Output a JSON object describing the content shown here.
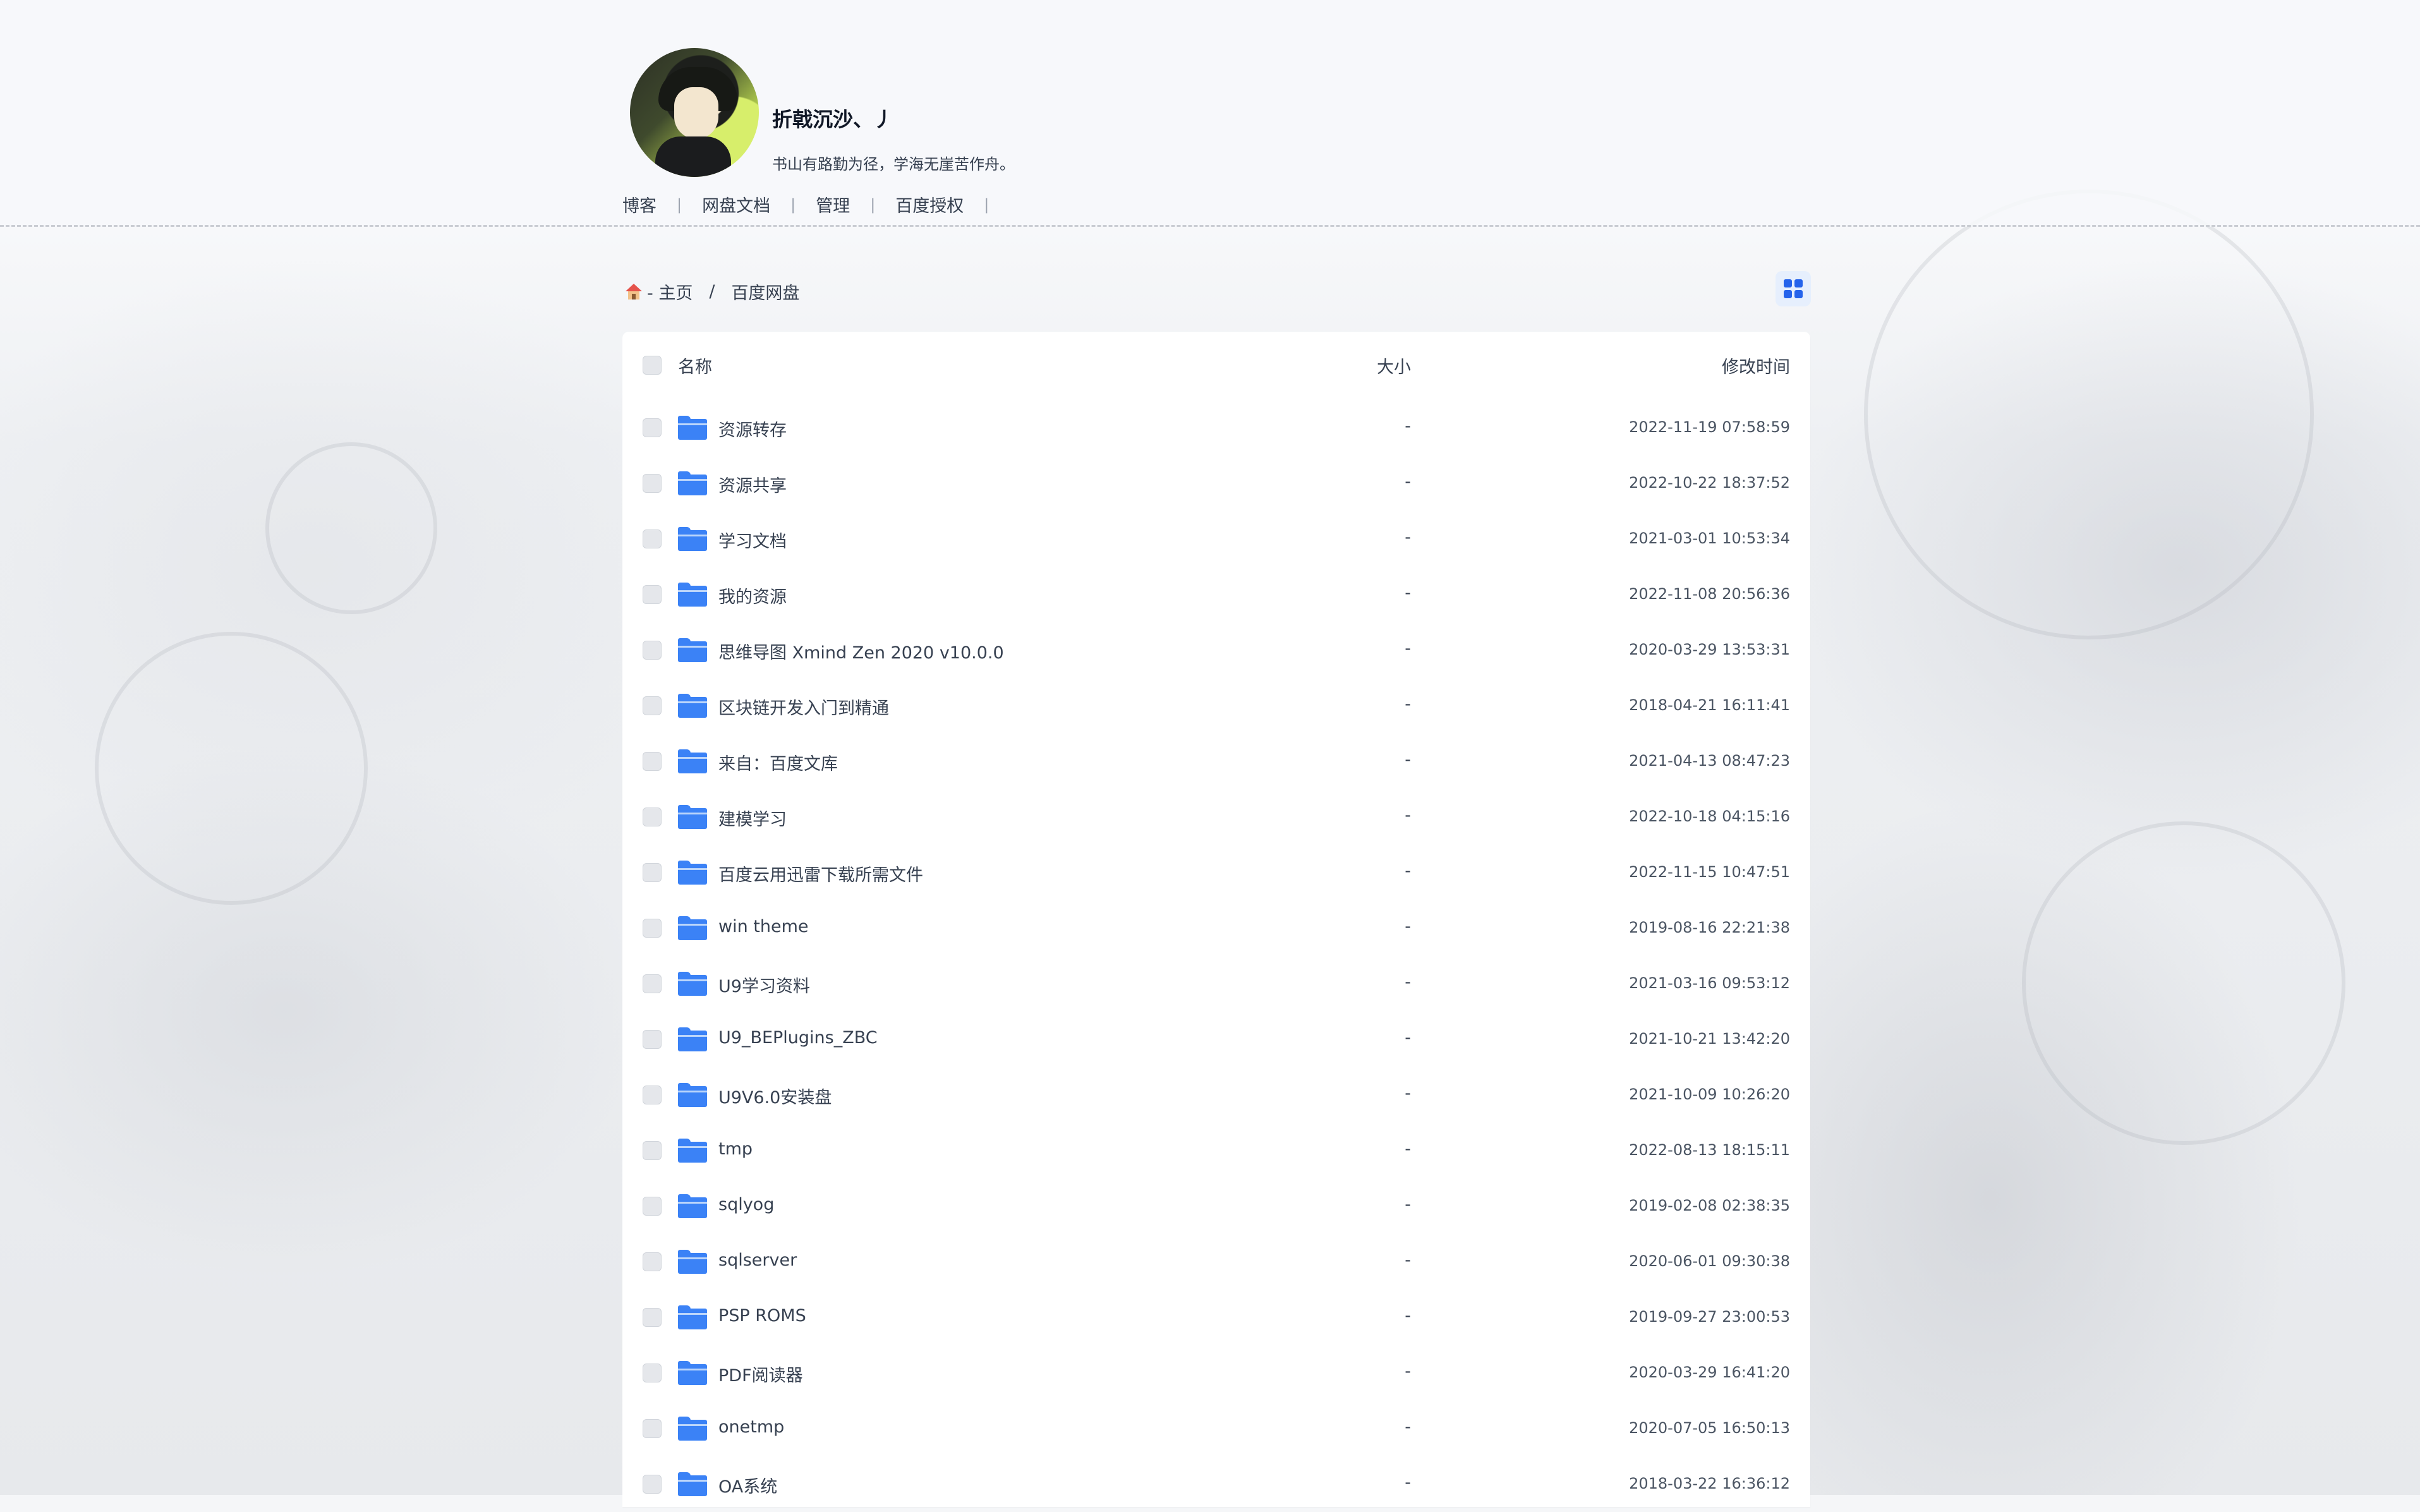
{
  "profile": {
    "username": "折戟沉沙、丿",
    "motto": "书山有路勤为径，学海无崖苦作舟。"
  },
  "nav": {
    "items": [
      {
        "label": "博客"
      },
      {
        "label": "网盘文档"
      },
      {
        "label": "管理"
      },
      {
        "label": "百度授权"
      }
    ],
    "separator": "|"
  },
  "breadcrumb": {
    "home_label": "- 主页",
    "separator": "/",
    "current": "百度网盘"
  },
  "table": {
    "headers": {
      "name": "名称",
      "size": "大小",
      "modified": "修改时间"
    },
    "rows": [
      {
        "name": "资源转存",
        "size": "-",
        "modified": "2022-11-19 07:58:59"
      },
      {
        "name": "资源共享",
        "size": "-",
        "modified": "2022-10-22 18:37:52"
      },
      {
        "name": "学习文档",
        "size": "-",
        "modified": "2021-03-01 10:53:34"
      },
      {
        "name": "我的资源",
        "size": "-",
        "modified": "2022-11-08 20:56:36"
      },
      {
        "name": "思维导图 Xmind Zen 2020 v10.0.0",
        "size": "-",
        "modified": "2020-03-29 13:53:31"
      },
      {
        "name": "区块链开发入门到精通",
        "size": "-",
        "modified": "2018-04-21 16:11:41"
      },
      {
        "name": "来自：百度文库",
        "size": "-",
        "modified": "2021-04-13 08:47:23"
      },
      {
        "name": "建模学习",
        "size": "-",
        "modified": "2022-10-18 04:15:16"
      },
      {
        "name": "百度云用迅雷下载所需文件",
        "size": "-",
        "modified": "2022-11-15 10:47:51"
      },
      {
        "name": "win theme",
        "size": "-",
        "modified": "2019-08-16 22:21:38"
      },
      {
        "name": "U9学习资料",
        "size": "-",
        "modified": "2021-03-16 09:53:12"
      },
      {
        "name": "U9_BEPlugins_ZBC",
        "size": "-",
        "modified": "2021-10-21 13:42:20"
      },
      {
        "name": "U9V6.0安装盘",
        "size": "-",
        "modified": "2021-10-09 10:26:20"
      },
      {
        "name": "tmp",
        "size": "-",
        "modified": "2022-08-13 18:15:11"
      },
      {
        "name": "sqlyog",
        "size": "-",
        "modified": "2019-02-08 02:38:35"
      },
      {
        "name": "sqlserver",
        "size": "-",
        "modified": "2020-06-01 09:30:38"
      },
      {
        "name": "PSP ROMS",
        "size": "-",
        "modified": "2019-09-27 23:00:53"
      },
      {
        "name": "PDF阅读器",
        "size": "-",
        "modified": "2020-03-29 16:41:20"
      },
      {
        "name": "onetmp",
        "size": "-",
        "modified": "2020-07-05 16:50:13"
      },
      {
        "name": "OA系统",
        "size": "-",
        "modified": "2018-03-22 16:36:12"
      }
    ]
  },
  "colors": {
    "accent": "#3b82f6",
    "toggle_bg": "#e6effd",
    "text": "#374151"
  },
  "icons": {
    "home": "home-icon",
    "folder": "folder-icon",
    "view_toggle": "grid-view-icon"
  }
}
